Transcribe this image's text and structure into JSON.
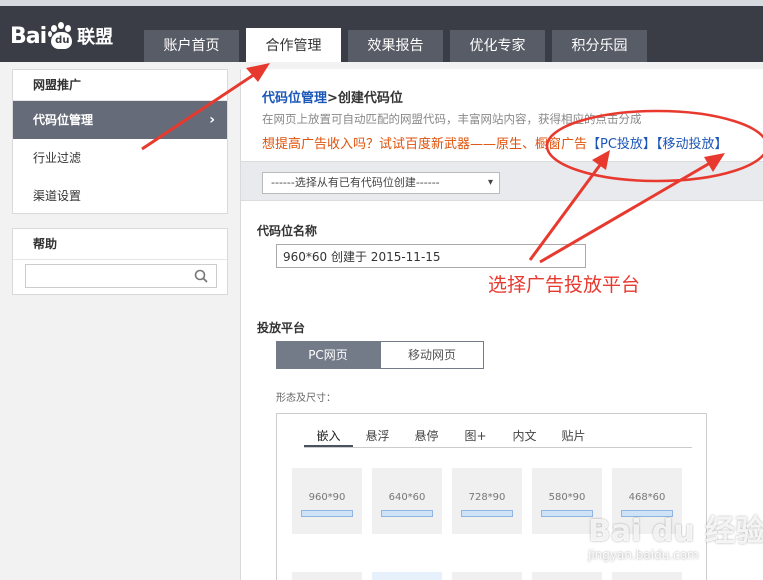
{
  "header": {
    "logo_bai": "Bai",
    "logo_du": "du",
    "logo_lianmeng": "联盟",
    "tabs": [
      {
        "label": "账户首页"
      },
      {
        "label": "合作管理"
      },
      {
        "label": "效果报告"
      },
      {
        "label": "优化专家"
      },
      {
        "label": "积分乐园"
      }
    ],
    "active_tab": "合作管理"
  },
  "sidebar": {
    "section_title": "网盟推广",
    "items": [
      {
        "label": "代码位管理",
        "active": true
      },
      {
        "label": "行业过滤"
      },
      {
        "label": "渠道设置"
      }
    ],
    "help_title": "帮助",
    "help_search_value": ""
  },
  "main": {
    "breadcrumb_link": "代码位管理",
    "breadcrumb_sep": ">",
    "breadcrumb_current": "创建代码位",
    "description": "在网页上放置可自动匹配的网盟代码，丰富网站内容，获得相应的点击分成",
    "promo_text": "想提高广告收入吗？试试百度新武器——原生、橱窗广告",
    "promo_pc": "【PC投放】",
    "promo_mobile": "【移动投放】",
    "select_text": "------选择从有已有代码位创建------",
    "code_name_label": "代码位名称",
    "code_name_value": "960*60 创建于 2015-11-15",
    "platform_label": "投放平台",
    "platform_buttons": [
      {
        "label": "PC网页",
        "selected": true
      },
      {
        "label": "移动网页",
        "selected": false
      }
    ],
    "shape_label": "形态及尺寸：",
    "shape_tabs": [
      {
        "label": "嵌入",
        "active": true
      },
      {
        "label": "悬浮"
      },
      {
        "label": "悬停"
      },
      {
        "label": "图+"
      },
      {
        "label": "内文"
      },
      {
        "label": "贴片"
      }
    ],
    "sizes": [
      "960*90",
      "640*60",
      "728*90",
      "580*90",
      "468*60"
    ]
  },
  "annotation": {
    "text": "选择广告投放平台",
    "color": "#e8392f"
  },
  "watermark": {
    "logo": "Bai du 经验",
    "url": "jingyan.baidu.com"
  },
  "colors": {
    "header_bg": "#3a3d45",
    "tab_bg": "#585c66",
    "sidebar_active": "#656b78",
    "link_blue": "#1a56b8",
    "promo_orange": "#e0520a"
  }
}
